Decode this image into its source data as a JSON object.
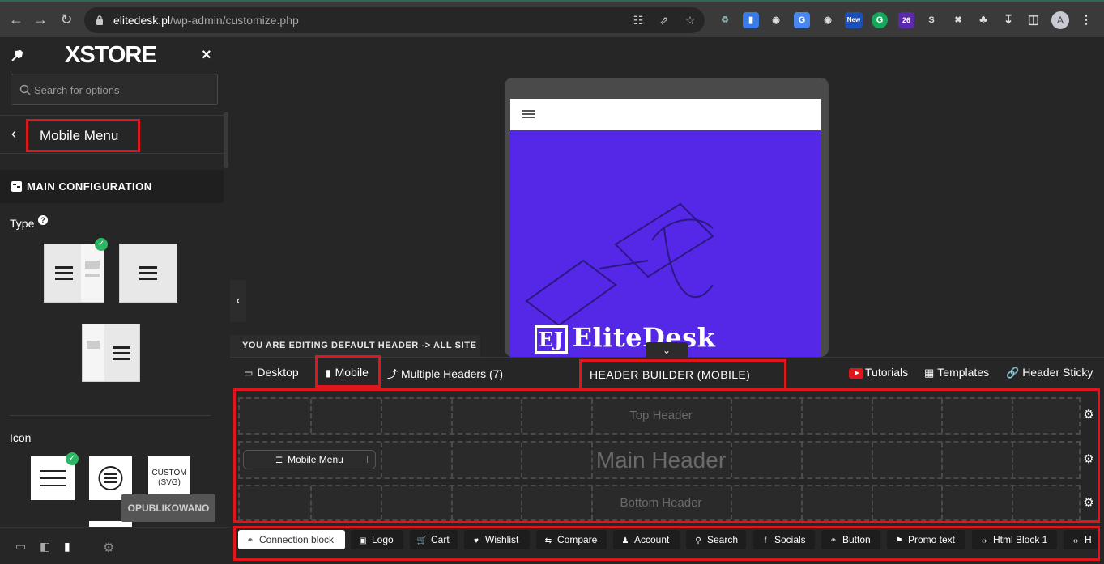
{
  "browser": {
    "host": "elitedesk.pl",
    "path": "/wp-admin/customize.php",
    "ext_new_badge": "New",
    "ext_count_badge": "26",
    "avatar_letter": "A"
  },
  "sidebar": {
    "logo": "XSTORE",
    "search_placeholder": "Search for options",
    "panel_title": "Mobile Menu",
    "section_title": "MAIN CONFIGURATION",
    "type_label": "Type",
    "icon_label": "Icon",
    "custom_icon_label": "CUSTOM (SVG)",
    "publish_label": "OPUBLIKOWANO"
  },
  "preview": {
    "brand_text": "EliteDesk"
  },
  "builder": {
    "editing_banner": "YOU ARE EDITING DEFAULT HEADER -> ALL SITE",
    "tabs": {
      "desktop": "Desktop",
      "mobile": "Mobile",
      "multiple_headers": "Multiple Headers (7)"
    },
    "title": "HEADER BUILDER (MOBILE)",
    "right_tabs": {
      "tutorials": "Tutorials",
      "templates": "Templates",
      "header_sticky": "Header Sticky"
    },
    "rows": {
      "top": "Top Header",
      "main": "Main Header",
      "bottom": "Bottom Header"
    },
    "mobile_menu_chip": "Mobile Menu",
    "elements": [
      "Connection block",
      "Logo",
      "Cart",
      "Wishlist",
      "Compare",
      "Account",
      "Search",
      "Socials",
      "Button",
      "Promo text",
      "Html Block 1",
      "H"
    ]
  },
  "colors": {
    "highlight_red": "#e0161f",
    "check_green": "#2eb667",
    "preview_purple": "#5428e6"
  }
}
